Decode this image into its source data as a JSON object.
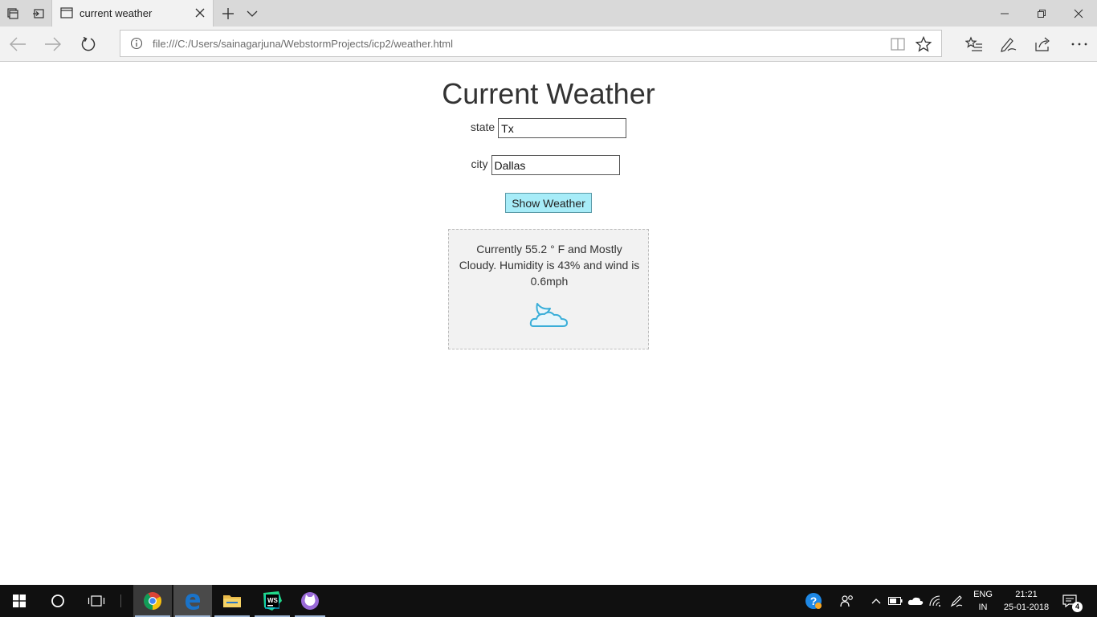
{
  "browser": {
    "tab_title": "current weather",
    "url": "file:///C:/Users/sainagarjuna/WebstormProjects/icp2/weather.html"
  },
  "page": {
    "heading": "Current Weather",
    "state_label": "state",
    "state_value": "Tx",
    "city_label": "city",
    "city_value": "Dallas",
    "button_label": "Show Weather",
    "weather_text": "Currently 55.2 ° F and Mostly Cloudy. Humidity is 43% and wind is 0.6mph",
    "weather_icon": "moon-cloud-icon"
  },
  "taskbar": {
    "language_line1": "ENG",
    "language_line2": "IN",
    "time": "21:21",
    "date": "25-01-2018",
    "notification_count": "4"
  },
  "colors": {
    "button_bg": "#a7ecf8",
    "weather_box_bg": "#f2f2f2",
    "taskbar_bg": "#101010",
    "edge_blue": "#1a73c9"
  }
}
